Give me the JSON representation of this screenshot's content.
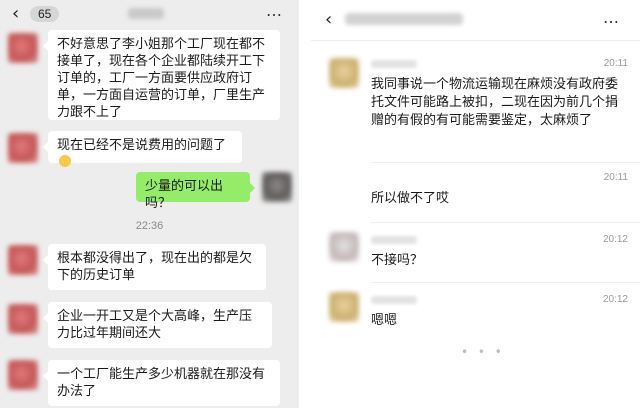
{
  "left_chat": {
    "header": {
      "unread_count": "65",
      "more_icon": "…"
    },
    "messages": [
      {
        "side": "in",
        "text": "不好意思了李小姐那个工厂现在都不接单了，现在各个企业都陆续开工下订单的，工厂一方面要供应政府订单，一方面自运营的订单，厂里生产力跟不上了"
      },
      {
        "side": "in",
        "text": "现在已经不是说费用的问题了"
      },
      {
        "side": "out",
        "text": "少量的可以出吗？"
      },
      {
        "side": "in",
        "text": "根本都没得出了，现在出的都是欠下的历史订单"
      },
      {
        "side": "in",
        "text": "企业一开工又是个大高峰，生产压力比过年期间还大"
      },
      {
        "side": "in",
        "text": "一个工厂能生产多少机器就在那没有办法了"
      }
    ],
    "divider_time": "22:36"
  },
  "right_chat": {
    "header": {
      "more_icon": "…"
    },
    "messages": [
      {
        "time": "20:11",
        "text": "我同事说一个物流运输现在麻烦没有政府委托文件可能路上被扣，二现在因为前几个捐赠的有假的有可能需要鉴定，太麻烦了"
      },
      {
        "time": "20:11",
        "text": "所以做不了哎"
      },
      {
        "time": "20:12",
        "text": "不接吗？"
      },
      {
        "time": "20:12",
        "text": "嗯嗯"
      }
    ]
  }
}
